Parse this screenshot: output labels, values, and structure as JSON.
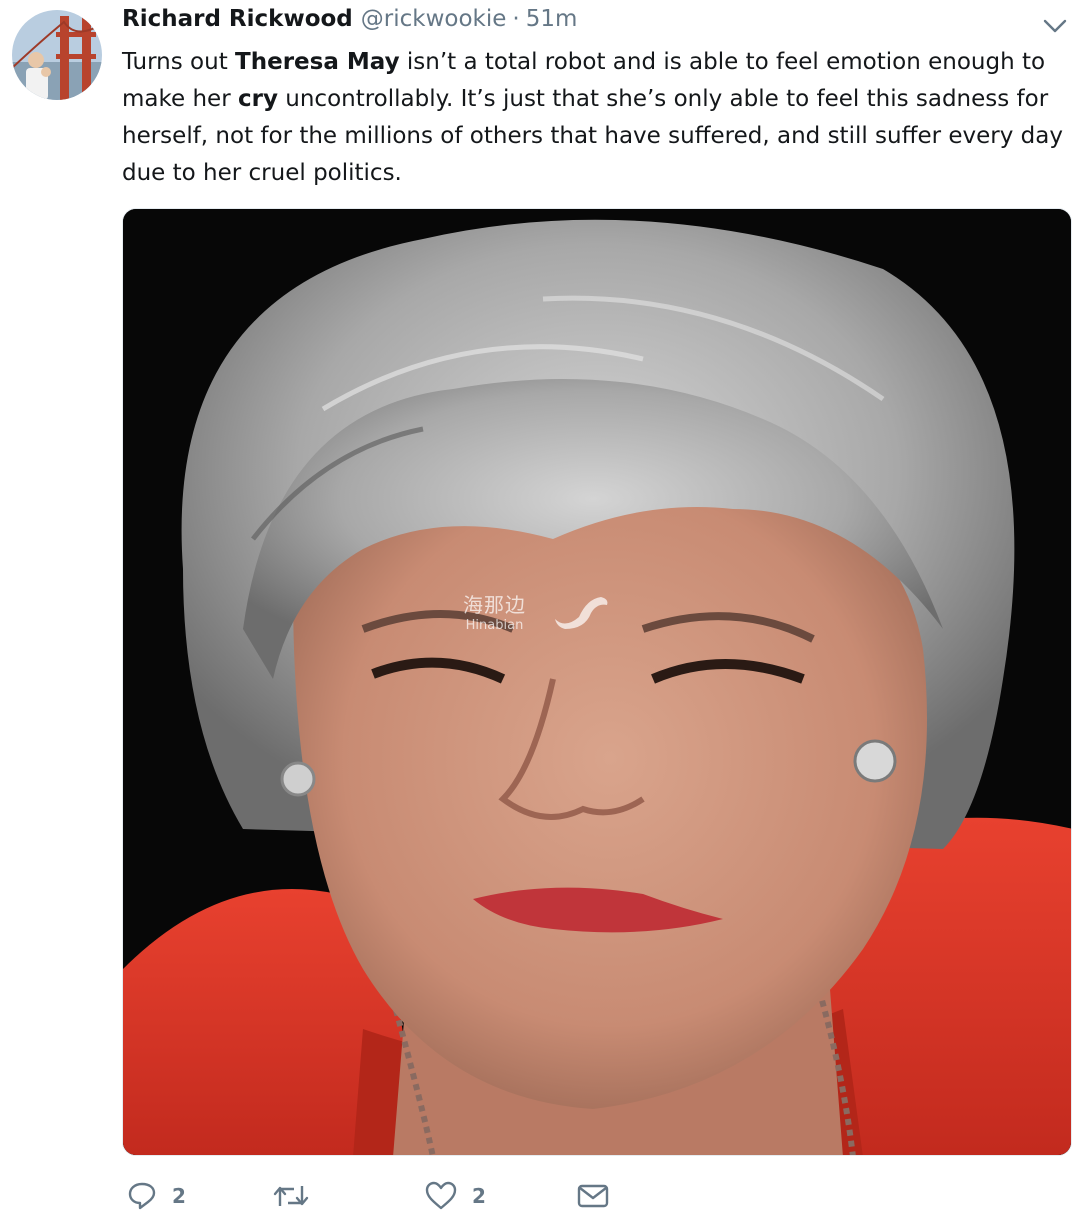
{
  "tweet": {
    "author_name": "Richard Rickwood",
    "handle": "@rickwookie",
    "separator": "·",
    "time": "51m",
    "text": {
      "l1_a": "Turns out ",
      "l1_b": "Theresa May",
      "l1_c": " isn’t a total robot and is able to feel emotion enough to",
      "l2_a": "make her ",
      "l2_b": "cry",
      "l2_c": " uncontrollably. It’s just that she’s only able to feel this sadness for",
      "l3": "herself, not for the millions of others that have suffered, and still suffer every day",
      "l4": "due to her cruel politics."
    },
    "media": {
      "watermark_cn": "海那边",
      "watermark_en": "Hinabian"
    },
    "actions": {
      "reply_count": "2",
      "retweet_count": "",
      "like_count": "2"
    }
  },
  "colors": {
    "text": "#14171a",
    "secondary": "#657786",
    "coat": "#e0392b"
  },
  "icons": [
    "chevron-down-icon",
    "reply-icon",
    "retweet-icon",
    "like-icon",
    "direct-message-icon"
  ]
}
